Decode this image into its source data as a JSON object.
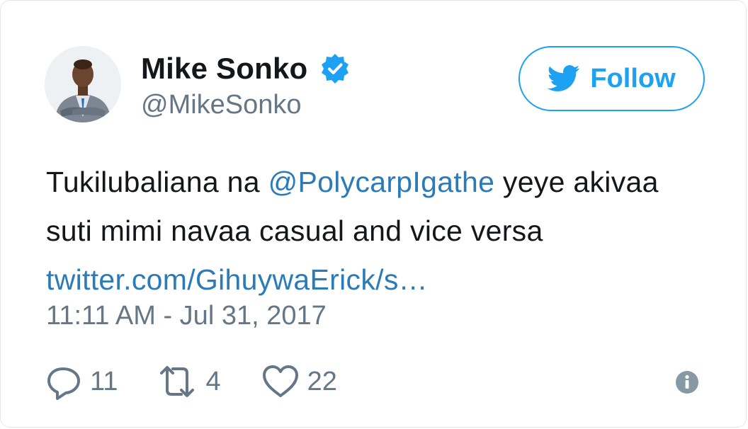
{
  "author": {
    "name": "Mike Sonko",
    "handle": "@MikeSonko",
    "verified": true
  },
  "follow": {
    "label": "Follow"
  },
  "tweet": {
    "text_1": "Tukilubaliana na ",
    "mention": "@PolycarpIgathe",
    "text_2": " yeye akivaa suti mimi navaa casual and vice versa ",
    "link": "twitter.com/GihuywaErick/s…",
    "timestamp": "11:11 AM - Jul 31, 2017"
  },
  "actions": {
    "replies": "11",
    "retweets": "4",
    "likes": "22"
  },
  "colors": {
    "accent": "#1da1f2",
    "link": "#2b7bb9",
    "text": "#14171a",
    "muted": "#657786"
  }
}
